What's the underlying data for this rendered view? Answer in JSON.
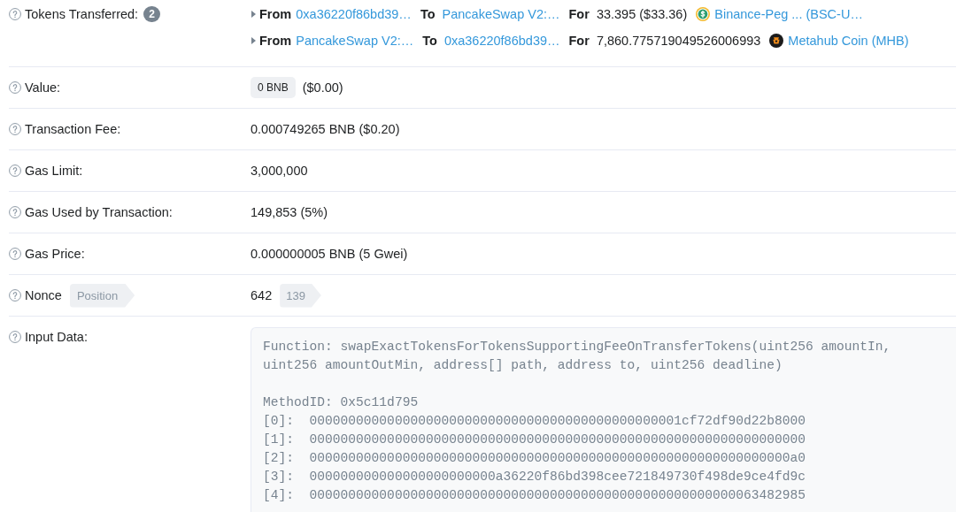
{
  "token_transfers": {
    "label": "Tokens Transferred:",
    "count": "2",
    "transfers": [
      {
        "kind": "usd",
        "from_label": "From",
        "from": "0xa36220f86bd39…",
        "to_label": "To",
        "to": "PancakeSwap V2:…",
        "for_label": "For",
        "amount": "33.395 ($33.36)",
        "token": "Binance-Peg ... (BSC-U…"
      },
      {
        "kind": "mhb",
        "from_label": "From",
        "from": "PancakeSwap V2:…",
        "to_label": "To",
        "to": "0xa36220f86bd39…",
        "for_label": "For",
        "amount": "7,860.775719049526006993",
        "token": "Metahub Coin (MHB)"
      }
    ]
  },
  "fields": [
    {
      "kind": "badge",
      "label": "Value:",
      "badge": "0 BNB",
      "value": "($0.00)"
    },
    {
      "kind": "text",
      "label": "Transaction Fee:",
      "value": "0.000749265 BNB ($0.20)"
    },
    {
      "kind": "text",
      "label": "Gas Limit:",
      "value": "3,000,000"
    },
    {
      "kind": "text",
      "label": "Gas Used by Transaction:",
      "value": "149,853 (5%)"
    },
    {
      "kind": "text",
      "label": "Gas Price:",
      "value": "0.000000005 BNB (5 Gwei)"
    },
    {
      "kind": "nonce",
      "label": "Nonce",
      "label_tag": "Position",
      "value": "642",
      "value_tag": "139"
    },
    {
      "kind": "code",
      "label": "Input Data:",
      "function": "Function: swapExactTokensForTokensSupportingFeeOnTransferTokens(uint256 amountIn, uint256 amountOutMin, address[] path, address to, uint256 deadline)",
      "method_id": "MethodID: 0x5c11d795",
      "params": [
        "[0]:  000000000000000000000000000000000000000000000001cf72df90d22b8000",
        "[1]:  0000000000000000000000000000000000000000000000000000000000000000",
        "[2]:  00000000000000000000000000000000000000000000000000000000000000a0",
        "[3]:  000000000000000000000000a36220f86bd398cee721849730f498de9ce4fd9c",
        "[4]:  0000000000000000000000000000000000000000000000000000000063482985"
      ]
    }
  ]
}
